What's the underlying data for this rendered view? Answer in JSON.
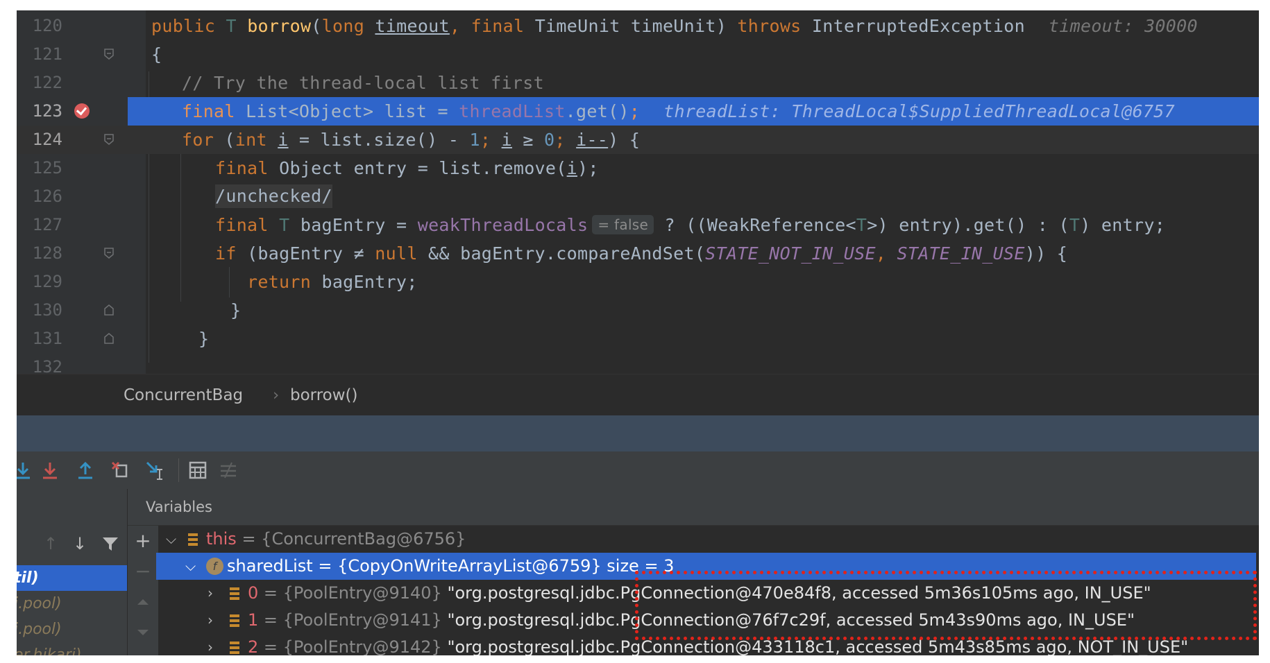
{
  "editor": {
    "lines": [
      {
        "num": "120",
        "hint": "timeout: 30000"
      },
      {
        "num": "121"
      },
      {
        "num": "122",
        "comment": "// Try the thread-local list first"
      },
      {
        "num": "123",
        "hint": "threadList: ThreadLocal$SuppliedThreadLocal@6757"
      },
      {
        "num": "124"
      },
      {
        "num": "125"
      },
      {
        "num": "126",
        "annotation": "/unchecked/"
      },
      {
        "num": "127",
        "inlay": "= false"
      },
      {
        "num": "128"
      },
      {
        "num": "129"
      },
      {
        "num": "130"
      },
      {
        "num": "131"
      },
      {
        "num": "132"
      }
    ],
    "code": {
      "l120": {
        "public": "public",
        "T": "T",
        "borrow": "borrow",
        "long": "long",
        "timeout": "timeout",
        "final": "final",
        "timeunit_param": "TimeUnit timeUnit)",
        "throws": "throws",
        "exception": "InterruptedException"
      },
      "l123": {
        "final": "final",
        "decl": "List<Object> list = ",
        "field": "threadList",
        "call": ".get()"
      },
      "l124": {
        "for": "for",
        "int": "int",
        "i": "i",
        "rest1": " = list.size() - ",
        "one": "1",
        "semi1": ";",
        "cond": " ≥ ",
        "zero": "0",
        "semi2": ";",
        "dec": "i--",
        "tail": ") {"
      },
      "l125": {
        "final": "final",
        "decl": "Object entry = list.remove(",
        "i": "i",
        "tail": ");"
      },
      "l127": {
        "final": "final",
        "T": "T",
        "var": "bagEntry = ",
        "field": "weakThreadLocals",
        "tern": " ? ((WeakReference<",
        "T2": "T",
        "mid": ">) entry).get() : (",
        "T3": "T",
        "tail": ") entry;"
      },
      "l128": {
        "if": "if",
        "cond": "(bagEntry ≠ ",
        "null": "null",
        "mid": " && bagEntry.compareAndSet(",
        "c1": "STATE_NOT_IN_USE",
        "comma": ", ",
        "c2": "STATE_IN_USE",
        "tail": ")) {"
      },
      "l129": {
        "return": "return",
        "rest": "bagEntry;"
      },
      "l130": {
        "brace": "}"
      },
      "l131": {
        "brace": "}"
      },
      "l121": {
        "brace": "{"
      }
    }
  },
  "breadcrumb": {
    "class_name": "ConcurrentBag",
    "separator": "›",
    "method": "borrow()"
  },
  "variables_panel": {
    "title": "Variables",
    "rows": [
      {
        "name": "this",
        "value": "= {ConcurrentBag@6756}"
      },
      {
        "name": "sharedList",
        "value": "= {CopyOnWriteArrayList@6759}  size = 3",
        "info_icon": "f"
      },
      {
        "name": "0",
        "value": "= {PoolEntry@9140}",
        "text": "\"org.postgresql.jdbc.PgConnection@470e84f8, accessed 5m36s105ms ago, IN_USE\""
      },
      {
        "name": "1",
        "value": "= {PoolEntry@9141}",
        "text": "\"org.postgresql.jdbc.PgConnection@76f7c29f, accessed 5m43s90ms ago, IN_USE\""
      },
      {
        "name": "2",
        "value": "= {PoolEntry@9142}",
        "text": "\"org.postgresql.jdbc.PgConnection@433118c1, accessed 5m43s85ms ago, NOT_IN_USE\""
      }
    ]
  },
  "frames_panel": {
    "items": [
      "til)",
      "i.pool)",
      "i.pool)",
      "er.hikari)"
    ]
  },
  "colors": {
    "selection": "#2f65ca",
    "keyword": "#cc7832",
    "annotation_box": "#e2231a"
  }
}
